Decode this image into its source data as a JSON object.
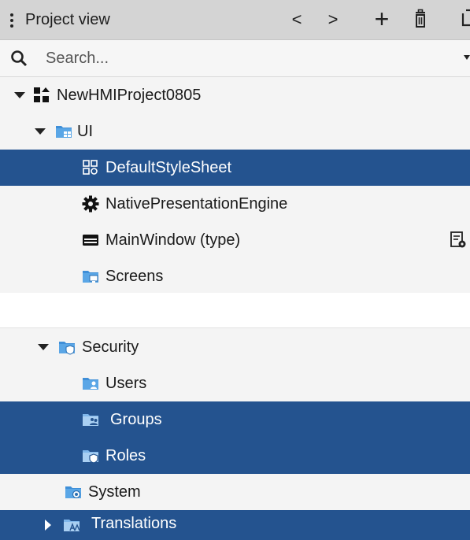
{
  "header": {
    "title": "Project view",
    "back_label": "<",
    "forward_label": ">",
    "add_label": "+"
  },
  "search": {
    "placeholder": "Search..."
  },
  "tree_top": [
    {
      "label": "NewHMIProject0805",
      "icon": "project-icon",
      "expanded": true
    },
    {
      "label": "UI",
      "icon": "ui-folder-icon",
      "expanded": true
    },
    {
      "label": "DefaultStyleSheet",
      "icon": "stylesheet-icon",
      "selected": true
    },
    {
      "label": "NativePresentationEngine",
      "icon": "gear-icon"
    },
    {
      "label": "MainWindow (type)",
      "icon": "window-icon"
    },
    {
      "label": "Screens",
      "icon": "screens-folder-icon"
    }
  ],
  "tree_bottom": [
    {
      "label": "Security",
      "icon": "security-folder-icon",
      "expanded": true
    },
    {
      "label": "Users",
      "icon": "users-folder-icon"
    },
    {
      "label": "Groups",
      "icon": "groups-folder-icon",
      "selected": true
    },
    {
      "label": "Roles",
      "icon": "roles-folder-icon",
      "selected": true
    },
    {
      "label": "System",
      "icon": "system-folder-icon"
    },
    {
      "label": "Translations",
      "icon": "translations-folder-icon",
      "selected": true,
      "expanded": false
    }
  ],
  "colors": {
    "selection": "#24538f",
    "folder": "#3f8fd8",
    "header": "#d4d4d4"
  }
}
